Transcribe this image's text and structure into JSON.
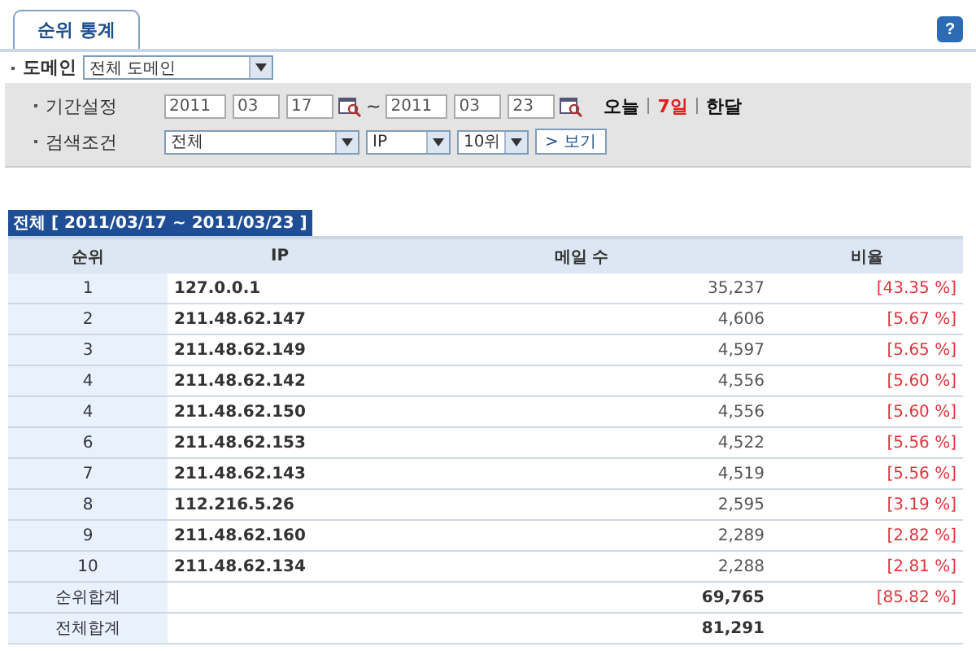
{
  "tabs": [
    {
      "label": "순위 통계",
      "selected": true
    }
  ],
  "help": {
    "label": "?"
  },
  "domain": {
    "label": "도메인",
    "value": "전체 도메인"
  },
  "period": {
    "label": "기간설정",
    "from": [
      "2011",
      "03",
      "17"
    ],
    "separator": "~",
    "to": [
      "2011",
      "03",
      "23"
    ],
    "quick_links": [
      {
        "label": "오늘",
        "selected": false
      },
      {
        "label": "7일",
        "selected": true
      },
      {
        "label": "한달",
        "selected": false
      }
    ]
  },
  "search": {
    "label": "검색조건",
    "filters": [
      "전체",
      "IP",
      "10위"
    ],
    "button": "> 보기"
  },
  "caption": "전체 [ 2011/03/17 ~ 2011/03/23 ]",
  "table": {
    "columns": [
      "순위",
      "IP",
      "메일 수",
      "비율"
    ],
    "rows": [
      {
        "rank": "1",
        "ip": "127.0.0.1",
        "count": "35,237",
        "ratio": "[43.35 %]"
      },
      {
        "rank": "2",
        "ip": "211.48.62.147",
        "count": "4,606",
        "ratio": "[5.67 %]"
      },
      {
        "rank": "3",
        "ip": "211.48.62.149",
        "count": "4,597",
        "ratio": "[5.65 %]"
      },
      {
        "rank": "4",
        "ip": "211.48.62.142",
        "count": "4,556",
        "ratio": "[5.60 %]"
      },
      {
        "rank": "4",
        "ip": "211.48.62.150",
        "count": "4,556",
        "ratio": "[5.60 %]"
      },
      {
        "rank": "6",
        "ip": "211.48.62.153",
        "count": "4,522",
        "ratio": "[5.56 %]"
      },
      {
        "rank": "7",
        "ip": "211.48.62.143",
        "count": "4,519",
        "ratio": "[5.56 %]"
      },
      {
        "rank": "8",
        "ip": "112.216.5.26",
        "count": "2,595",
        "ratio": "[3.19 %]"
      },
      {
        "rank": "9",
        "ip": "211.48.62.160",
        "count": "2,289",
        "ratio": "[2.82 %]"
      },
      {
        "rank": "10",
        "ip": "211.48.62.134",
        "count": "2,288",
        "ratio": "[2.81 %]"
      }
    ],
    "totals": [
      {
        "label": "순위합계",
        "count": "69,765",
        "ratio": "[85.82 %]"
      },
      {
        "label": "전체합계",
        "count": "81,291"
      }
    ]
  }
}
